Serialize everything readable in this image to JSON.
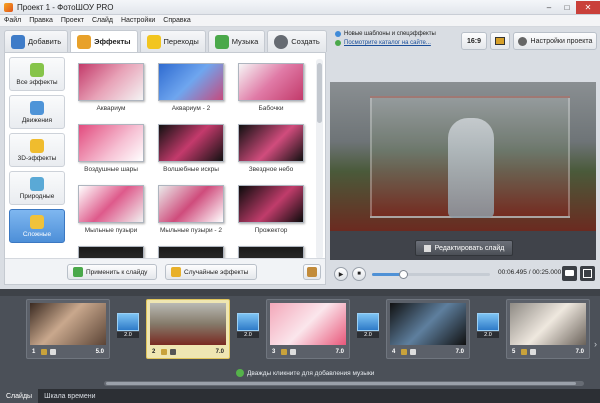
{
  "window": {
    "title": "Проект 1 - ФотоШОУ PRO",
    "min": "–",
    "max": "□",
    "close": "✕"
  },
  "menu": [
    "Файл",
    "Правка",
    "Проект",
    "Слайд",
    "Настройки",
    "Справка"
  ],
  "tabs": [
    {
      "label": "Добавить",
      "icon": "add-icon",
      "color": "#3f7cc8"
    },
    {
      "label": "Эффекты",
      "icon": "effects-icon",
      "color": "#e8a12a"
    },
    {
      "label": "Переходы",
      "icon": "star-icon",
      "color": "#f2c51f"
    },
    {
      "label": "Музыка",
      "icon": "music-icon",
      "color": "#4aa84a"
    },
    {
      "label": "Создать",
      "icon": "film-icon",
      "color": "#666b72"
    }
  ],
  "categories": [
    {
      "label": "Все эффекты",
      "icon": "puzzle-icon",
      "color": "#86c44a"
    },
    {
      "label": "Движения",
      "icon": "move-icon",
      "color": "#4e94d8"
    },
    {
      "label": "3D-эффекты",
      "icon": "cube-icon",
      "color": "#f0bc2e"
    },
    {
      "label": "Природные",
      "icon": "snowflake-icon",
      "color": "#5aa9d6"
    },
    {
      "label": "Сложные",
      "icon": "layers-icon",
      "color": "#f0c23a"
    }
  ],
  "effects": [
    {
      "label": "Аквариум",
      "bg": "linear-gradient(135deg,#c33a6a,#e8a3b8 50%,#f4f4f4)"
    },
    {
      "label": "Аквариум - 2",
      "bg": "linear-gradient(135deg,#2f6bd0,#6fa6ef 50%,#c64a7d)"
    },
    {
      "label": "Бабочки",
      "bg": "linear-gradient(135deg,#f6f6f6,#e07aa6 50%,#c23a6a)"
    },
    {
      "label": "Воздушные шары",
      "bg": "linear-gradient(135deg,#e24b7e,#f6c0d3 60%,#ffffff)"
    },
    {
      "label": "Волшебные искры",
      "bg": "linear-gradient(135deg,#111,#c43a6c 50%,#111)"
    },
    {
      "label": "Звездное небо",
      "bg": "linear-gradient(135deg,#101010,#d14c7d 55%,#101010)"
    },
    {
      "label": "Мыльные пузыри",
      "bg": "linear-gradient(135deg,#ffffff,#de5a8b 50%,#f1f1f1)"
    },
    {
      "label": "Мыльные пузыри - 2",
      "bg": "linear-gradient(135deg,#eaeaea,#cf4c7c 50%,#ffffff)"
    },
    {
      "label": "Прожектор",
      "bg": "linear-gradient(135deg,#0b0b0b,#c03c6b 55%,#0b0b0b)"
    },
    {
      "label": "",
      "bg": "linear-gradient(#1a1a1a,#444)"
    },
    {
      "label": "",
      "bg": "linear-gradient(#1a1a1a,#444)"
    },
    {
      "label": "",
      "bg": "linear-gradient(#1a1a1a,#444)"
    }
  ],
  "actions": {
    "apply": "Применить к слайду",
    "random": "Случайные эффекты"
  },
  "news": {
    "line1": "Новые шаблоны и спецэффекты",
    "line2": "Посмотрите каталог на сайте..."
  },
  "toolbar": {
    "ratio": "16:9",
    "settings": "Настройки проекта"
  },
  "preview": {
    "edit": "Редактировать слайд"
  },
  "player": {
    "current": "00:06.495",
    "total": "00:25.000",
    "progress": 0.26
  },
  "slides": [
    {
      "num": "1",
      "dur": "5.0",
      "bg": "linear-gradient(135deg,#3a2a22,#c9a88d 45%,#5b4436)"
    },
    {
      "num": "2",
      "dur": "7.0",
      "bg": "linear-gradient(#b9b9b4,#857a6a 50%,#7a2a22)",
      "active": true
    },
    {
      "num": "3",
      "dur": "7.0",
      "bg": "linear-gradient(135deg,#f3a7b9,#fbe6ec 50%,#e8577a)"
    },
    {
      "num": "4",
      "dur": "7.0",
      "bg": "linear-gradient(135deg,#111,#5e7f9e 50%,#111)"
    },
    {
      "num": "5",
      "dur": "7.0",
      "bg": "linear-gradient(135deg,#8e8a84,#efe8df 50%,#6a625a)"
    }
  ],
  "transitions": [
    "2.0",
    "2.0",
    "2.0",
    "2.0"
  ],
  "timeline": {
    "music_hint": "Дважды кликните для добавления музыки"
  },
  "footer": {
    "tab1": "Слайды",
    "tab2": "Шкала времени"
  }
}
